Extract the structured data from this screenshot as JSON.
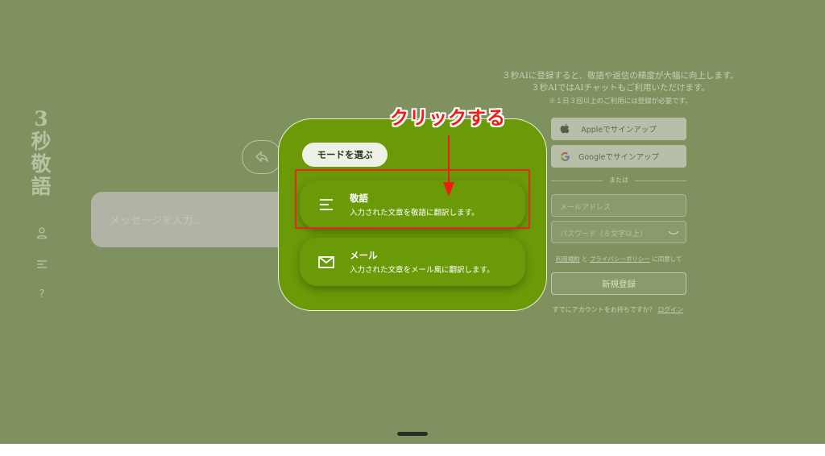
{
  "app": {
    "logo_vertical": [
      "3",
      "秒",
      "敬",
      "語"
    ]
  },
  "sidebar": {
    "icons": [
      "user-icon",
      "list-icon",
      "help-icon"
    ],
    "help_glyph": "?"
  },
  "composer": {
    "back_icon": "reply-icon",
    "placeholder": "メッセージを入力..."
  },
  "registration": {
    "line1": "３秒AIに登録すると、敬語や返信の精度が大幅に向上します。",
    "line2": "３秒AIではAIチャットもご利用いただけます。",
    "line3": "※１日３回以上のご利用には登録が必要です。",
    "apple_label": "Appleでサインアップ",
    "google_label": "Googleでサインアップ",
    "or_label": "または",
    "email_placeholder": "メールアドレス",
    "password_placeholder": "パスワード（８文字以上）",
    "terms_link": "利用規約",
    "terms_and": "と",
    "privacy_link": "プライバシーポリシー",
    "terms_agree": "に同意して",
    "signup_label": "新規登録",
    "login_prompt": "すでにアカウントをお持ちですか？",
    "login_link": "ログイン"
  },
  "mode_modal": {
    "title": "モードを選ぶ",
    "items": [
      {
        "icon": "list-icon",
        "title": "敬語",
        "description": "入力された文章を敬語に翻訳します。"
      },
      {
        "icon": "mail-icon",
        "title": "メール",
        "description": "入力された文章をメール風に翻訳します。"
      }
    ]
  },
  "annotation": {
    "callout": "クリックする",
    "color": "#ef1c12"
  },
  "colors": {
    "background": "#7f915f",
    "modal": "#6b9908"
  }
}
